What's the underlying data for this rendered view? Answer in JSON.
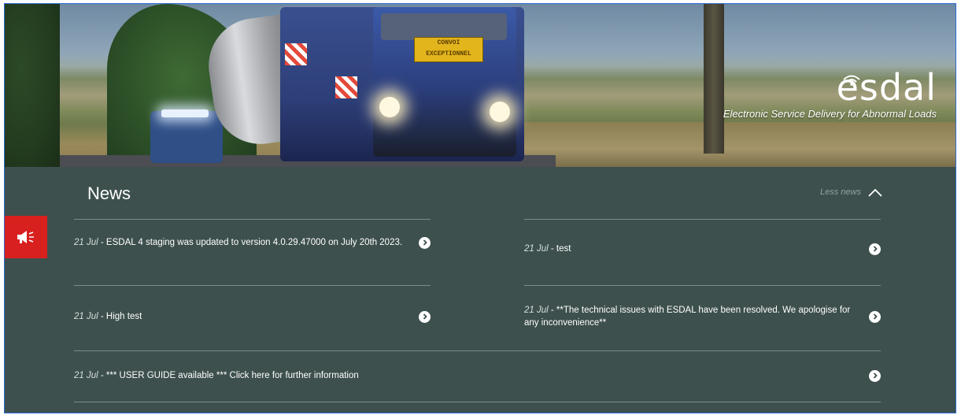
{
  "hero": {
    "convoy_sign_line1": "CONVOI",
    "convoy_sign_line2": "EXCEPTIONNEL",
    "logo_word": "esdal",
    "logo_tagline": "Electronic Service Delivery for Abnormal Loads"
  },
  "news": {
    "title": "News",
    "toggle_label": "Less news",
    "items": [
      {
        "date": "21 Jul",
        "separator": " - ",
        "text": "ESDAL 4 staging was updated to version 4.0.29.47000 on July 20th 2023."
      },
      {
        "date": "21 Jul",
        "separator": " - ",
        "text": "test"
      },
      {
        "date": "21 Jul",
        "separator": " - ",
        "text": "High test"
      },
      {
        "date": "21 Jul",
        "separator": " - ",
        "text": "**The technical issues with ESDAL have been resolved. We apologise for any inconvenience**"
      },
      {
        "date": "21 Jul",
        "separator": " - ",
        "text": "*** USER GUIDE available *** Click here for further information"
      }
    ]
  },
  "colors": {
    "panel_bg": "#3d504d",
    "accent_red": "#d8201f",
    "rule": "#7b8c89"
  }
}
